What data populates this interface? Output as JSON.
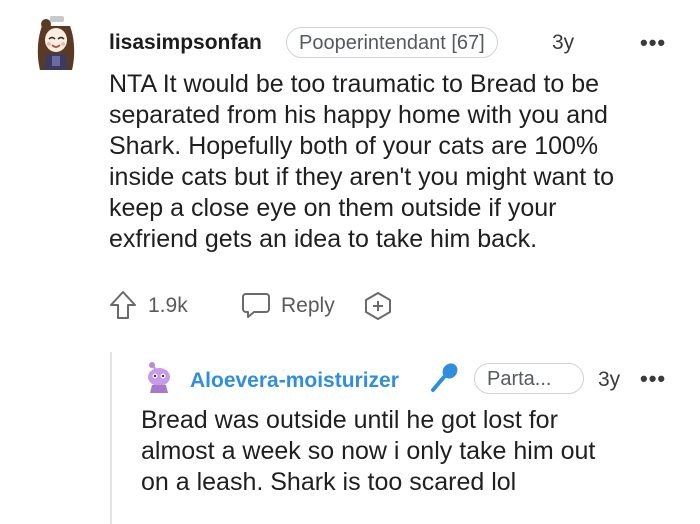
{
  "comments": [
    {
      "username": "lisasimpsonfan",
      "flair": "Pooperintendant [67]",
      "age": "3y",
      "more": "•••",
      "body_lines": [
        "NTA It would be too traumatic to Bread to be",
        "separated from his happy home with you and",
        "Shark. Hopefully both of your cats are 100%",
        "inside cats but if they aren't you might want to",
        "keep a close eye on them outside if your",
        "exfriend gets an idea to take him back."
      ],
      "votes": "1.9k",
      "reply_label": "Reply"
    },
    {
      "username": "Aloevera-moisturizer",
      "flair": "Parta...",
      "age": "3y",
      "more": "•••",
      "body_lines": [
        "Bread was outside until he got lost for",
        "almost a week so now i only take him out",
        "on a leash. Shark is too scared lol"
      ]
    }
  ],
  "colors": {
    "reply_username": "#2f8fde",
    "mic_icon": "#2f8fde"
  },
  "icons": [
    "avatar",
    "upvote-icon",
    "reply-bubble-icon",
    "award-add-icon",
    "avatar-alien",
    "microphone-icon",
    "more-icon"
  ]
}
